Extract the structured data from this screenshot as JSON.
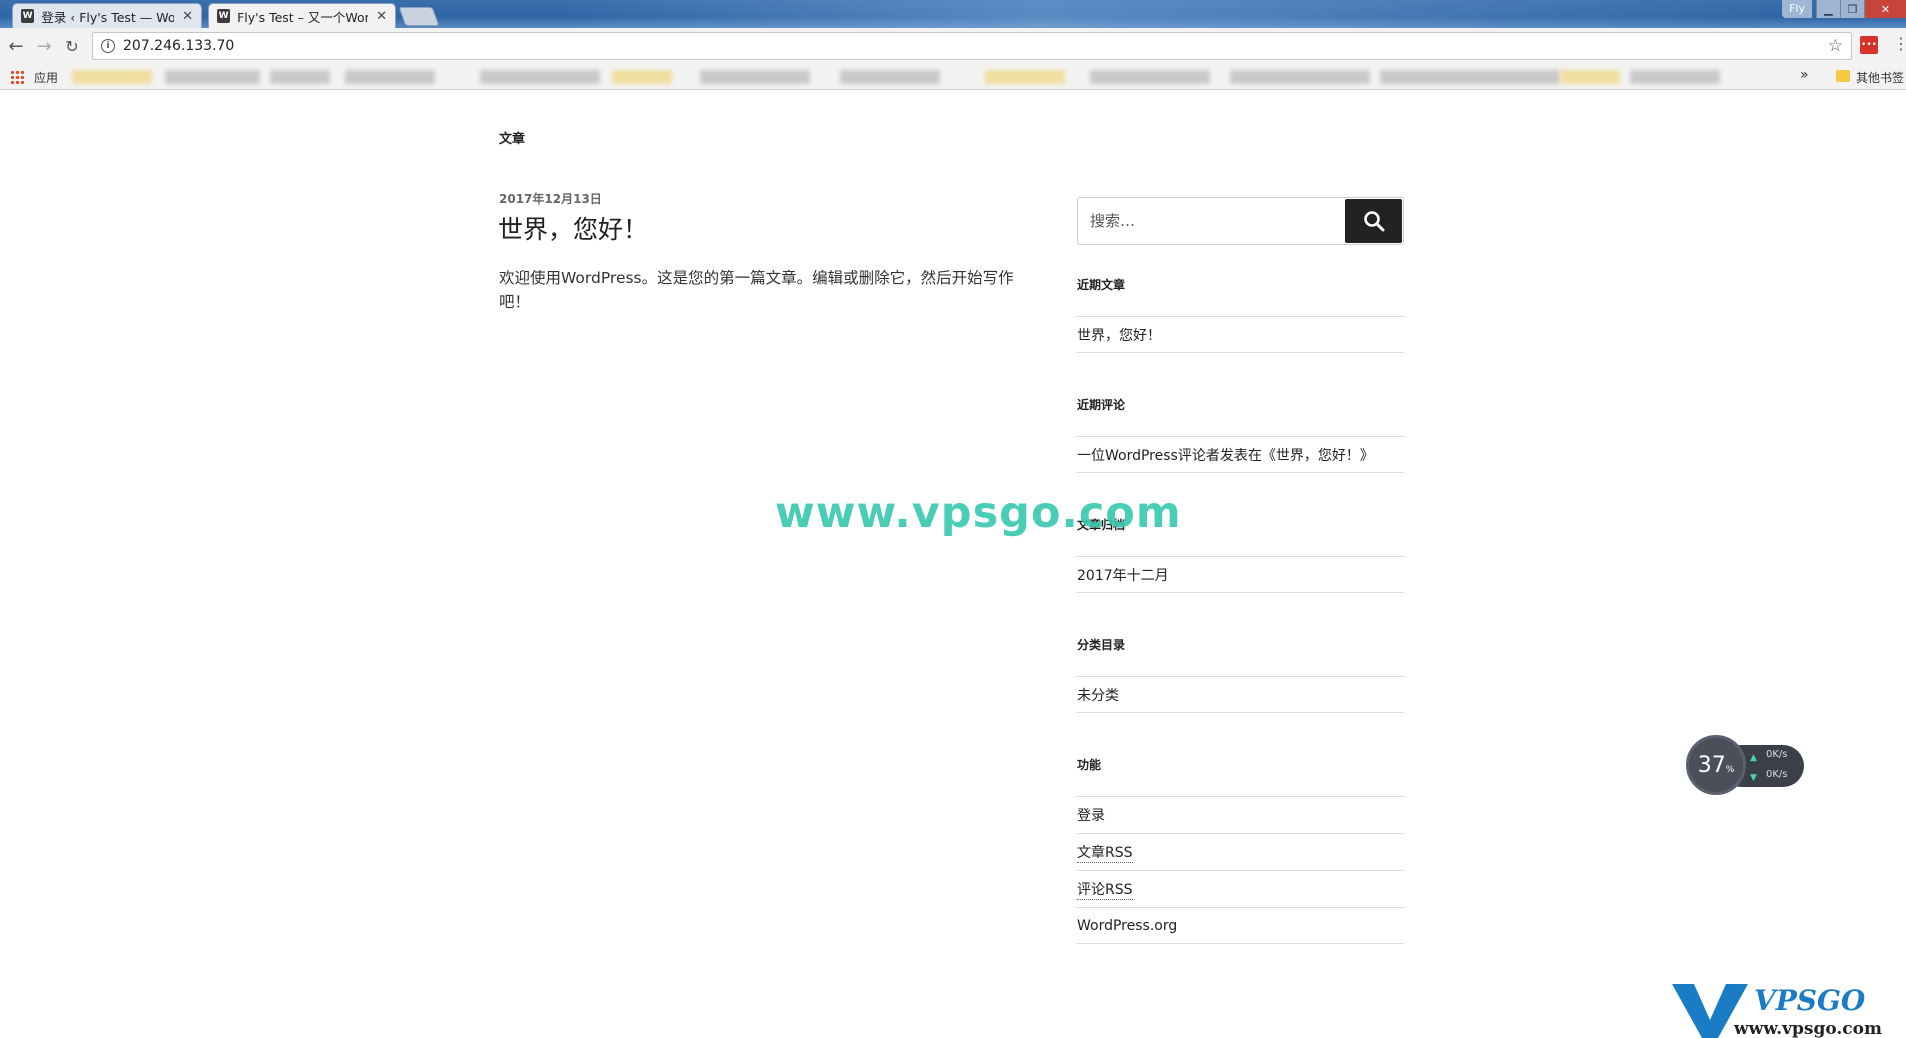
{
  "browser": {
    "tabs": [
      {
        "title": "登录 ‹ Fly's Test — Wor",
        "active": false
      },
      {
        "title": "Fly's Test – 又一个Word",
        "active": true
      }
    ],
    "window_label": "Fly",
    "url": "207.246.133.70",
    "bookmarks": {
      "apps_label": "应用",
      "more": "»",
      "other_label": "其他书签"
    }
  },
  "page": {
    "heading": "文章",
    "post": {
      "date": "2017年12月13日",
      "title": "世界，您好！",
      "body": "欢迎使用WordPress。这是您的第一篇文章。编辑或删除它，然后开始写作吧！"
    },
    "sidebar": {
      "search_placeholder": "搜索…",
      "widgets": [
        {
          "title": "近期文章",
          "items": [
            "世界，您好！"
          ]
        },
        {
          "title": "近期评论",
          "items": [
            "一位WordPress评论者发表在《世界，您好！》"
          ]
        },
        {
          "title": "文章归档",
          "items": [
            "2017年十二月"
          ]
        },
        {
          "title": "分类目录",
          "items": [
            "未分类"
          ]
        },
        {
          "title": "功能",
          "items": [
            "登录",
            "文章RSS",
            "评论RSS",
            "WordPress.org"
          ]
        }
      ]
    }
  },
  "overlays": {
    "watermark": "www.vpsgo.com",
    "speed_percent": "37",
    "speed_unit": "%",
    "upload": "0K/s",
    "download": "0K/s",
    "logo_text": "VPSGO",
    "logo_url": "www.vpsgo.com"
  },
  "colors": {
    "accent": "#222222",
    "watermark": "#3bc9b0",
    "logo": "#1a7cc4"
  }
}
